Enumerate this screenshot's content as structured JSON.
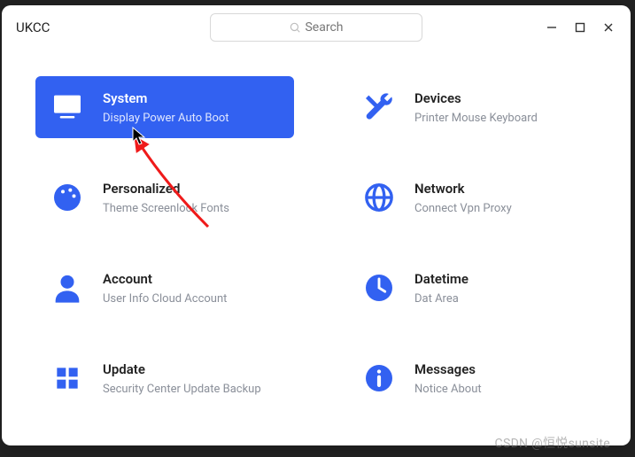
{
  "window": {
    "title": "UKCC"
  },
  "search": {
    "placeholder": "Search"
  },
  "cards": {
    "system": {
      "title": "System",
      "subtitle": "Display  Power  Auto Boot"
    },
    "devices": {
      "title": "Devices",
      "subtitle": "Printer  Mouse  Keyboard"
    },
    "personalized": {
      "title": "Personalized",
      "subtitle": "Theme  Screenlock  Fonts"
    },
    "network": {
      "title": "Network",
      "subtitle": "Connect  Vpn  Proxy"
    },
    "account": {
      "title": "Account",
      "subtitle": "User Info  Cloud Account"
    },
    "datetime": {
      "title": "Datetime",
      "subtitle": "Dat  Area"
    },
    "update": {
      "title": "Update",
      "subtitle": "Security Center  Update  Backup"
    },
    "messages": {
      "title": "Messages",
      "subtitle": "Notice  About"
    }
  },
  "watermark": "CSDN @恒悦sunsite",
  "colors": {
    "accent": "#3261f1"
  }
}
